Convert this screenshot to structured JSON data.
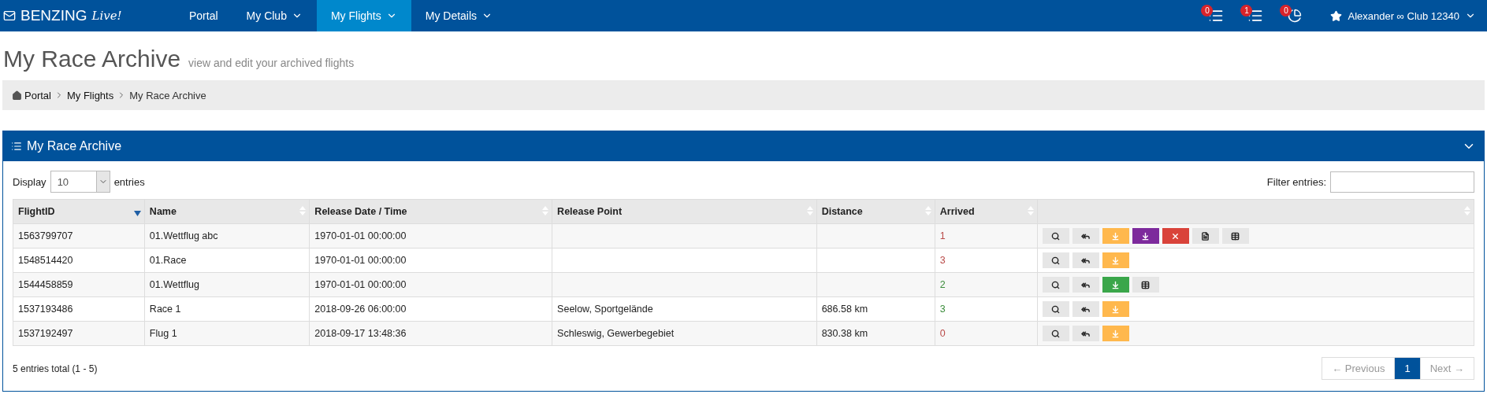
{
  "brand": {
    "name": "BENZING",
    "script": "Live!"
  },
  "nav": [
    {
      "label": "Portal",
      "dropdown": false,
      "selected": false
    },
    {
      "label": "My Club",
      "dropdown": true,
      "selected": false
    },
    {
      "label": "My Flights",
      "dropdown": true,
      "selected": true
    },
    {
      "label": "My Details",
      "dropdown": true,
      "selected": false
    }
  ],
  "notifications": [
    {
      "kind": "list",
      "count": "0"
    },
    {
      "kind": "list",
      "count": "1"
    },
    {
      "kind": "chart",
      "count": "0"
    }
  ],
  "user": {
    "label": "Alexander ∞ Club 12340"
  },
  "page": {
    "title": "My Race Archive",
    "subtitle": "view and edit your archived flights"
  },
  "breadcrumb": [
    "Portal",
    "My Flights",
    "My Race Archive"
  ],
  "panel": {
    "title": "My Race Archive",
    "display": {
      "label": "Display",
      "value": "10",
      "suffix": "entries"
    },
    "filter": {
      "label": "Filter entries:"
    },
    "columns": [
      {
        "label": "FlightID",
        "sorted": true
      },
      {
        "label": "Name",
        "sorted": false
      },
      {
        "label": "Release Date / Time",
        "sorted": false
      },
      {
        "label": "Release Point",
        "sorted": false
      },
      {
        "label": "Distance",
        "sorted": false
      },
      {
        "label": "Arrived",
        "sorted": false
      },
      {
        "sorted": false
      }
    ],
    "rows": [
      {
        "id": "1563799707",
        "name": "01.Wettflug abc",
        "release": "1970-01-01 00:00:00",
        "point": "",
        "distance": "",
        "arrived": "1",
        "color": "#b94a48",
        "actions": [
          {
            "kind": "view"
          },
          {
            "kind": "reply"
          },
          {
            "kind": "upload"
          },
          {
            "kind": "export"
          },
          {
            "kind": "delete"
          },
          {
            "kind": "file"
          },
          {
            "kind": "table"
          }
        ]
      },
      {
        "id": "1548514420",
        "name": "01.Race",
        "release": "1970-01-01 00:00:00",
        "point": "",
        "distance": "",
        "arrived": "3",
        "color": "#b94a48",
        "actions": [
          {
            "kind": "view"
          },
          {
            "kind": "reply"
          },
          {
            "kind": "upload"
          }
        ]
      },
      {
        "id": "1544458859",
        "name": "01.Wettflug",
        "release": "1970-01-01 00:00:00",
        "point": "",
        "distance": "",
        "arrived": "2",
        "color": "#3c8d3c",
        "actions": [
          {
            "kind": "view"
          },
          {
            "kind": "reply"
          },
          {
            "kind": "done"
          },
          {
            "kind": "table"
          }
        ]
      },
      {
        "id": "1537193486",
        "name": "Race 1",
        "release": "2018-09-26 06:00:00",
        "point": "Seelow, Sportgelände",
        "distance": "686.58 km",
        "arrived": "3",
        "color": "#3c8d3c",
        "actions": [
          {
            "kind": "view"
          },
          {
            "kind": "reply"
          },
          {
            "kind": "upload"
          }
        ]
      },
      {
        "id": "1537192497",
        "name": "Flug 1",
        "release": "2018-09-17 13:48:36",
        "point": "Schleswig, Gewerbegebiet",
        "distance": "830.38 km",
        "arrived": "0",
        "color": "#b94a48",
        "actions": [
          {
            "kind": "view"
          },
          {
            "kind": "reply"
          },
          {
            "kind": "upload"
          }
        ]
      }
    ],
    "summary": "5 entries total (1 - 5)",
    "pagination": [
      {
        "label": "← Previous",
        "selected": false,
        "disabled": true
      },
      {
        "label": "1",
        "selected": true,
        "disabled": false
      },
      {
        "label": "Next →",
        "selected": false,
        "disabled": true
      }
    ]
  }
}
